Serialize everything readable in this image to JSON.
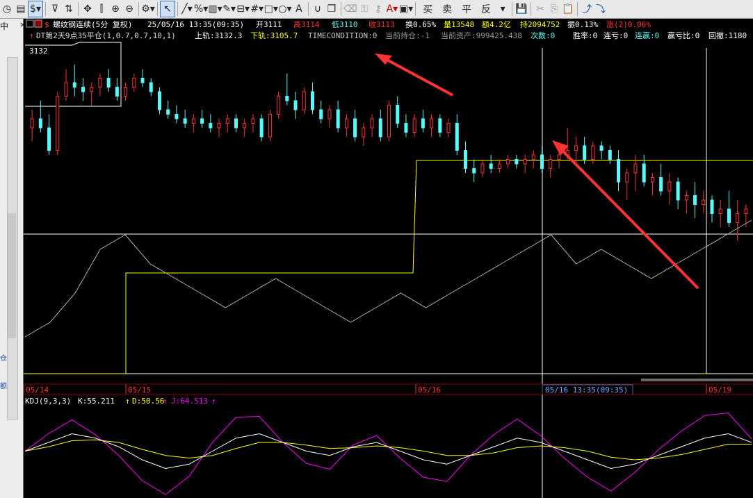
{
  "toolbar": {
    "icons": [
      "timer-icon",
      "doc-icon",
      "dollar-icon",
      "filter-icon",
      "refresh-icon",
      "move-icon",
      "split-icon",
      "zoom-in-icon",
      "zoom-out-icon",
      "gear-icon",
      "pointer-icon",
      "line-icon",
      "percent-icon",
      "ruler-icon",
      "pen-icon",
      "indicator-icon",
      "grid-icon",
      "rect-icon",
      "ellipse-icon",
      "text-icon",
      "magnet-icon",
      "copy-icon",
      "delete-icon",
      "lock-icon",
      "unlock-icon",
      "color-icon",
      "window-icon",
      "save-icon",
      "cut-icon",
      "copy2-icon",
      "paste-icon",
      "up-icon",
      "down-icon"
    ],
    "buttons": {
      "buy": "买",
      "sell": "卖",
      "flat": "平",
      "reverse": "反"
    }
  },
  "left_panel": {
    "label": "中",
    "side1": "仓",
    "side2": "额"
  },
  "chart_header": {
    "symbol": "螺纹钢连续(5分 复权)",
    "datetime": "25/05/16 13:35(09:35)",
    "open": "开3111",
    "high": "高3114",
    "low": "低3110",
    "close": "收3113",
    "turnover": "换0.65%",
    "volume": "量13548",
    "amount": "额4.2亿",
    "hold": "持2094752",
    "amp": "振0.13%",
    "change": "涨(2)0.06%"
  },
  "strategy_line": {
    "name": "DT第2天9点35平仓(1,0.7,0.7,10,1)",
    "upper": "上轨:3132.3",
    "lower": "下轨:3105.7",
    "timecond": "TIMECONDITION:0",
    "position": "当前持仓:-1",
    "assets": "当前资产:999425.438",
    "count": "次数:0",
    "winrate": "胜率:0",
    "lossstreak": "连亏:0",
    "winstreak": "连赢:0",
    "pnlratio": "赢亏比:0",
    "drawdown": "回撤:1180"
  },
  "price_label": "3132",
  "dates": [
    "05/14",
    "05/15",
    "05/16",
    "05/16 13:35(09:35)",
    "05/19"
  ],
  "kdj": {
    "name": "KDJ(9,3,3)",
    "k": "K:55.211",
    "d": "D:50.56",
    "j": "J:64.513"
  },
  "colors": {
    "up": "#ff3232",
    "down": "#54fcfc",
    "yellow": "#ffff00",
    "white": "#ffffff",
    "magenta": "#ff00ff",
    "red_text": "#ff3232",
    "grid": "#8b0000"
  },
  "chart_data": {
    "type": "line",
    "y_range_price": [
      3096,
      3136
    ],
    "candles": [
      [
        3118,
        3122,
        3115,
        3120
      ],
      [
        3120,
        3124,
        3117,
        3118
      ],
      [
        3118,
        3121,
        3112,
        3113
      ],
      [
        3113,
        3126,
        3112,
        3125
      ],
      [
        3125,
        3131,
        3124,
        3128
      ],
      [
        3128,
        3132,
        3125,
        3127
      ],
      [
        3127,
        3129,
        3124,
        3126
      ],
      [
        3126,
        3128,
        3123,
        3127
      ],
      [
        3127,
        3130,
        3125,
        3129
      ],
      [
        3129,
        3131,
        3126,
        3127
      ],
      [
        3127,
        3129,
        3124,
        3125
      ],
      [
        3125,
        3128,
        3124,
        3127
      ],
      [
        3127,
        3130,
        3126,
        3129
      ],
      [
        3129,
        3131,
        3127,
        3128
      ],
      [
        3128,
        3129,
        3125,
        3126
      ],
      [
        3126,
        3127,
        3121,
        3122
      ],
      [
        3122,
        3124,
        3120,
        3121
      ],
      [
        3121,
        3123,
        3119,
        3120
      ],
      [
        3120,
        3122,
        3118,
        3119
      ],
      [
        3119,
        3121,
        3117,
        3120
      ],
      [
        3120,
        3122,
        3118,
        3119
      ],
      [
        3119,
        3121,
        3117,
        3118
      ],
      [
        3118,
        3120,
        3116,
        3119
      ],
      [
        3119,
        3121,
        3117,
        3120
      ],
      [
        3120,
        3121,
        3117,
        3118
      ],
      [
        3118,
        3120,
        3116,
        3119
      ],
      [
        3119,
        3121,
        3117,
        3120
      ],
      [
        3120,
        3121,
        3115,
        3116
      ],
      [
        3116,
        3122,
        3115,
        3121
      ],
      [
        3121,
        3126,
        3120,
        3125
      ],
      [
        3125,
        3130,
        3123,
        3124
      ],
      [
        3124,
        3126,
        3120,
        3122
      ],
      [
        3122,
        3127,
        3121,
        3126
      ],
      [
        3126,
        3128,
        3121,
        3122
      ],
      [
        3122,
        3124,
        3119,
        3120
      ],
      [
        3120,
        3123,
        3118,
        3122
      ],
      [
        3122,
        3124,
        3117,
        3118
      ],
      [
        3118,
        3121,
        3116,
        3120
      ],
      [
        3120,
        3122,
        3115,
        3116
      ],
      [
        3116,
        3119,
        3114,
        3118
      ],
      [
        3118,
        3121,
        3116,
        3120
      ],
      [
        3120,
        3122,
        3115,
        3116
      ],
      [
        3116,
        3124,
        3115,
        3123
      ],
      [
        3123,
        3125,
        3118,
        3119
      ],
      [
        3119,
        3121,
        3116,
        3117
      ],
      [
        3117,
        3121,
        3116,
        3120
      ],
      [
        3120,
        3122,
        3117,
        3118
      ],
      [
        3118,
        3121,
        3116,
        3120
      ],
      [
        3120,
        3121,
        3116,
        3117
      ],
      [
        3117,
        3120,
        3116,
        3119
      ],
      [
        3119,
        3121,
        3112,
        3113
      ],
      [
        3113,
        3115,
        3108,
        3109
      ],
      [
        3109,
        3111,
        3106,
        3108
      ],
      [
        3108,
        3111,
        3107,
        3110
      ],
      [
        3110,
        3112,
        3108,
        3109
      ],
      [
        3109,
        3111,
        3108,
        3110
      ],
      [
        3110,
        3112,
        3109,
        3111
      ],
      [
        3111,
        3112,
        3109,
        3110
      ],
      [
        3110,
        3112,
        3108,
        3111
      ],
      [
        3111,
        3113,
        3109,
        3112
      ],
      [
        3112,
        3114,
        3108,
        3109
      ],
      [
        3109,
        3112,
        3107,
        3111
      ],
      [
        3111,
        3114,
        3109,
        3112
      ],
      [
        3112,
        3118,
        3111,
        3113
      ],
      [
        3113,
        3116,
        3110,
        3114
      ],
      [
        3114,
        3116,
        3110,
        3111
      ],
      [
        3111,
        3115,
        3110,
        3114
      ],
      [
        3114,
        3115,
        3111,
        3113
      ],
      [
        3113,
        3114,
        3110,
        3111
      ],
      [
        3111,
        3113,
        3104,
        3106
      ],
      [
        3106,
        3109,
        3102,
        3108
      ],
      [
        3108,
        3112,
        3104,
        3110
      ],
      [
        3110,
        3112,
        3105,
        3106
      ],
      [
        3106,
        3108,
        3103,
        3107
      ],
      [
        3107,
        3110,
        3103,
        3104
      ],
      [
        3104,
        3108,
        3101,
        3106
      ],
      [
        3106,
        3107,
        3100,
        3102
      ],
      [
        3102,
        3104,
        3099,
        3103
      ],
      [
        3103,
        3106,
        3098,
        3101
      ],
      [
        3101,
        3104,
        3099,
        3102
      ],
      [
        3102,
        3103,
        3097,
        3099
      ],
      [
        3099,
        3102,
        3096,
        3100
      ],
      [
        3100,
        3104,
        3096,
        3097
      ],
      [
        3097,
        3102,
        3093,
        3099
      ],
      [
        3099,
        3101,
        3096,
        3100
      ]
    ],
    "upper_band": [
      3132.3,
      3132.3,
      3132.3,
      3132.3
    ],
    "equity": [
      0.2,
      0.3,
      0.5,
      0.8,
      0.9,
      0.7,
      0.6,
      0.5,
      0.4,
      0.5,
      0.6,
      0.5,
      0.4,
      0.3,
      0.4,
      0.5,
      0.4,
      0.5,
      0.6,
      0.7,
      0.8,
      0.9,
      0.7,
      0.8,
      0.7,
      0.6,
      0.7,
      0.8,
      0.9,
      1.0
    ],
    "kdj_k": [
      50,
      60,
      70,
      65,
      55,
      40,
      30,
      35,
      50,
      65,
      70,
      60,
      50,
      45,
      55,
      60,
      50,
      40,
      35,
      45,
      55,
      65,
      60,
      50,
      40,
      30,
      35,
      45,
      55,
      65,
      70,
      60
    ],
    "kdj_d": [
      50,
      55,
      62,
      63,
      60,
      52,
      45,
      42,
      45,
      53,
      60,
      60,
      57,
      53,
      54,
      56,
      54,
      50,
      45,
      45,
      48,
      54,
      56,
      54,
      50,
      43,
      40,
      42,
      46,
      52,
      58,
      58
    ],
    "kdj_j": [
      50,
      70,
      86,
      69,
      45,
      16,
      0,
      21,
      60,
      89,
      90,
      60,
      36,
      29,
      57,
      68,
      42,
      20,
      15,
      45,
      69,
      87,
      68,
      42,
      20,
      4,
      25,
      51,
      73,
      91,
      94,
      64
    ]
  }
}
